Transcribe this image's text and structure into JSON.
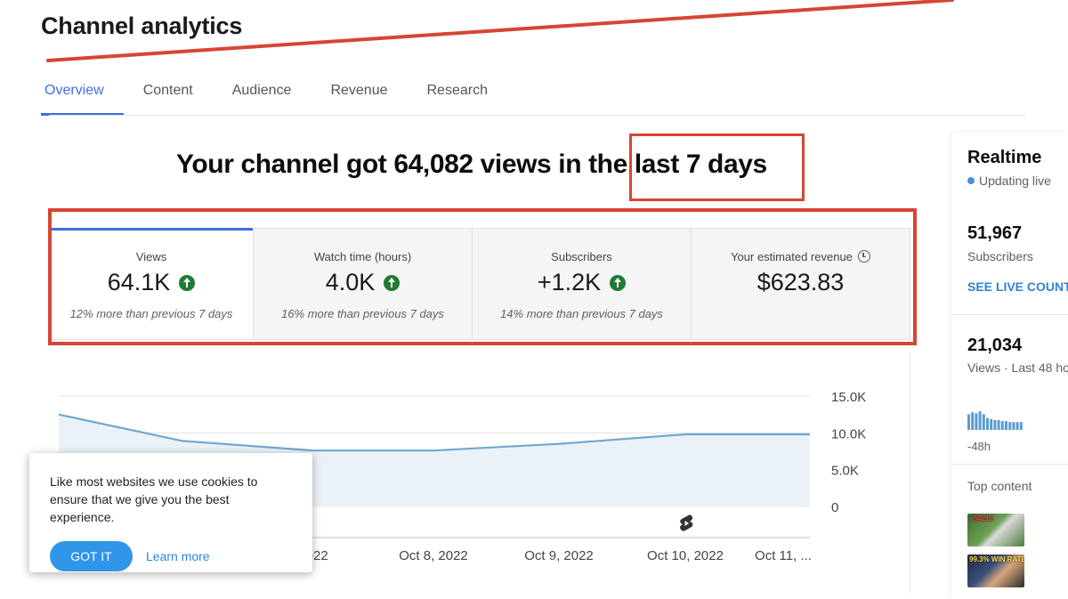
{
  "page": {
    "title": "Channel analytics"
  },
  "tabs": [
    {
      "label": "Overview",
      "active": true
    },
    {
      "label": "Content"
    },
    {
      "label": "Audience"
    },
    {
      "label": "Revenue"
    },
    {
      "label": "Research"
    }
  ],
  "headline": {
    "before": "Your channel got 64,082 views in the ",
    "highlight": "last 7 days"
  },
  "metrics": [
    {
      "label": "Views",
      "value": "64.1K",
      "trend": "up",
      "compare": "12% more than previous 7 days"
    },
    {
      "label": "Watch time (hours)",
      "value": "4.0K",
      "trend": "up",
      "compare": "16% more than previous 7 days"
    },
    {
      "label": "Subscribers",
      "value": "+1.2K",
      "trend": "up",
      "compare": "14% more than previous 7 days"
    },
    {
      "label": "Your estimated revenue",
      "value": "$623.83",
      "icon": "clock-icon"
    }
  ],
  "chart_data": {
    "type": "area",
    "x": [
      "",
      "",
      "2022",
      "Oct 8, 2022",
      "Oct 9, 2022",
      "Oct 10, 2022",
      "Oct 11, ..."
    ],
    "series": [
      {
        "values": [
          12500,
          8900,
          7600,
          7600,
          8500,
          9800,
          9800
        ]
      }
    ],
    "y_ticks": [
      "15.0K",
      "10.0K",
      "5.0K",
      "0"
    ],
    "ylim": [
      0,
      15000
    ],
    "grid": true,
    "color": "#6fa8cf"
  },
  "cookie": {
    "message": "Like most websites we use cookies to ensure that we give you the best experience.",
    "accept_label": "GOT IT",
    "learn_more_label": "Learn more"
  },
  "realtime": {
    "title": "Realtime",
    "status": "Updating live",
    "subscribers_value": "51,967",
    "subscribers_label": "Subscribers",
    "see_live_label": "SEE LIVE COUNT",
    "views_value": "21,034",
    "views_label": "Views · Last 48 hours",
    "range_label": "-48h",
    "top_content_label": "Top content",
    "bar_values": [
      0.8,
      0.9,
      0.85,
      0.95,
      0.8,
      0.6,
      0.55,
      0.5,
      0.5,
      0.45,
      0.45,
      0.4,
      0.4,
      0.4,
      0.4
    ],
    "thumbs": [
      {
        "tag": "+54212"
      },
      {
        "tag": "99.3% WIN RATE"
      }
    ]
  },
  "annotations": {
    "color": "#d74534"
  }
}
